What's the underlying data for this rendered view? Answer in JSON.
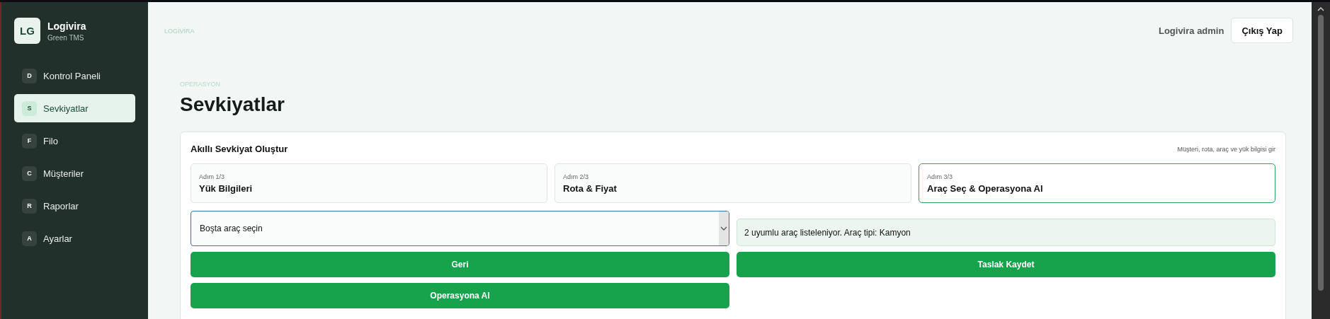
{
  "brand": {
    "logo": "LG",
    "name": "Logivira",
    "subtitle": "Green TMS"
  },
  "sidebar": {
    "items": [
      {
        "letter": "D",
        "label": "Kontrol Paneli",
        "selected": false
      },
      {
        "letter": "S",
        "label": "Sevkiyatlar",
        "selected": true
      },
      {
        "letter": "F",
        "label": "Filo",
        "selected": false
      },
      {
        "letter": "C",
        "label": "Müşteriler",
        "selected": false
      },
      {
        "letter": "R",
        "label": "Raporlar",
        "selected": false
      },
      {
        "letter": "A",
        "label": "Ayarlar",
        "selected": false
      }
    ]
  },
  "header": {
    "breadcrumb": "LOGİVİRA",
    "user": "Logivira admin",
    "logout": "Çıkış Yap"
  },
  "page": {
    "eyebrow": "OPERASYON",
    "title": "Sevkiyatlar"
  },
  "card": {
    "title": "Akıllı Sevkiyat Oluştur",
    "hint": "Müşteri, rota, araç ve yük bilgisi gir",
    "steps": [
      {
        "step": "Adım 1/3",
        "label": "Yük Bilgileri",
        "selected": false
      },
      {
        "step": "Adım 2/3",
        "label": "Rota & Fiyat",
        "selected": false
      },
      {
        "step": "Adım 3/3",
        "label": "Araç Seç & Operasyona Al",
        "selected": true
      }
    ],
    "select": {
      "value": "Boşta araç seçin"
    },
    "info": "2 uyumlu araç listeleniyor. Araç tipi: Kamyon",
    "buttons": [
      "Geri",
      "Taslak Kaydet",
      "Operasyona Al"
    ]
  }
}
